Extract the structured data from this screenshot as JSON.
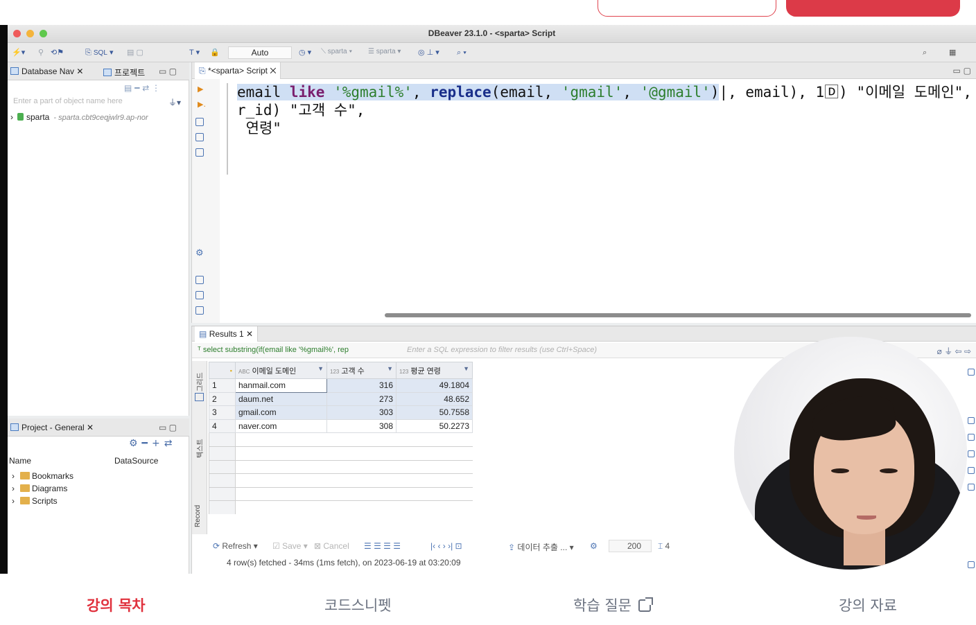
{
  "window": {
    "title": "DBeaver 23.1.0 - <sparta> Script"
  },
  "toolbar": {
    "sql_label": "SQL",
    "commit_mode": "Auto",
    "datasource": "sparta",
    "schema": "sparta"
  },
  "nav_panel": {
    "tab_database": "Database Nav",
    "tab_project": "프로젝트",
    "filter_placeholder": "Enter a part of object name here",
    "connection_name": "sparta",
    "connection_host": "- sparta.cbt9ceqjwlr9.ap-nor"
  },
  "project_panel": {
    "tab": "Project - General",
    "col_name": "Name",
    "col_datasource": "DataSource",
    "items": [
      "Bookmarks",
      "Diagrams",
      "Scripts"
    ]
  },
  "editor": {
    "tab": "*<sparta> Script",
    "line1_pre": "email ",
    "line1_kw": "like",
    "line1_s1": " '%gmail%'",
    "line1_mid1": ", ",
    "line1_fn": "replace",
    "line1_mid2": "(email, ",
    "line1_s2": "'gmail'",
    "line1_mid3": ", ",
    "line1_s3": "'@gmail'",
    "line1_mid4": ")",
    "line1_rest": "|, email), 1🄳) \"이메일 도메인\",",
    "line2": "r_id) \"고객 수\",",
    "line3": " 연령\""
  },
  "results": {
    "tab": "Results 1",
    "query_preview": "select substring(if(email like '%gmail%', rep",
    "filter_placeholder": "Enter a SQL expression to filter results (use Ctrl+Space)",
    "columns": [
      {
        "type": "ABC",
        "name": "이메일 도메인"
      },
      {
        "type": "123",
        "name": "고객 수"
      },
      {
        "type": "123",
        "name": "평균 연령"
      }
    ],
    "rows": [
      {
        "n": "1",
        "domain": "hanmail.com",
        "count": "316",
        "avg": "49.1804"
      },
      {
        "n": "2",
        "domain": "daum.net",
        "count": "273",
        "avg": "48.652"
      },
      {
        "n": "3",
        "domain": "gmail.com",
        "count": "303",
        "avg": "50.7558"
      },
      {
        "n": "4",
        "domain": "naver.com",
        "count": "308",
        "avg": "50.2273"
      }
    ],
    "side_grid": "그리드",
    "side_text": "텍스트",
    "side_record": "Record",
    "refresh": "Refresh",
    "save": "Save",
    "cancel": "Cancel",
    "export": "데이터 추출 ...",
    "fetch_size": "200",
    "row_count": "4",
    "status": "4 row(s) fetched - 34ms (1ms fetch), on 2023-06-19 at 03:20:09"
  },
  "bottom_nav": {
    "items": [
      "강의 목차",
      "코드스니펫",
      "학습 질문",
      "강의 자료"
    ]
  },
  "colors": {
    "accent": "#e0313d",
    "selection": "#cfdff4"
  }
}
